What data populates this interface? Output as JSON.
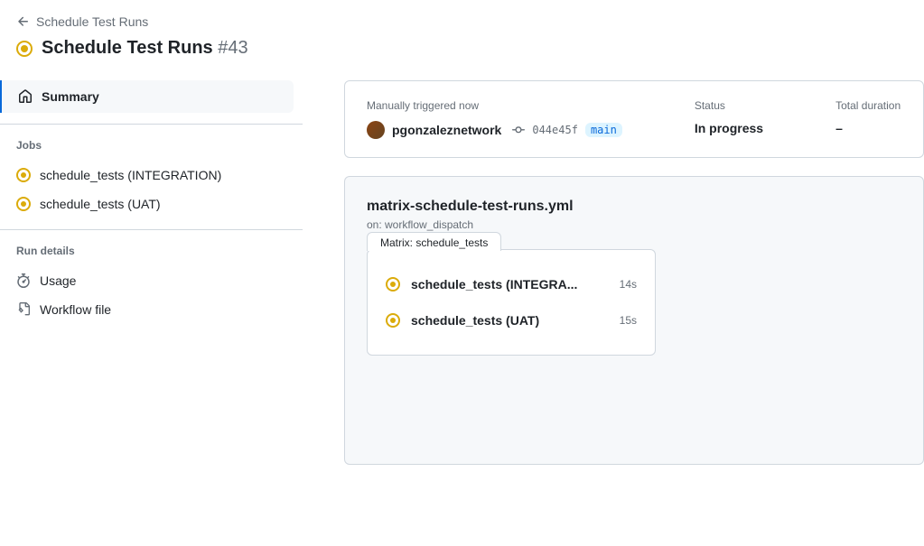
{
  "breadcrumb": {
    "parent": "Schedule Test Runs"
  },
  "title": {
    "name": "Schedule Test Runs",
    "run_number": "#43"
  },
  "sidebar": {
    "summary_label": "Summary",
    "jobs_label": "Jobs",
    "jobs": [
      {
        "name": "schedule_tests (INTEGRATION)"
      },
      {
        "name": "schedule_tests (UAT)"
      }
    ],
    "run_details_label": "Run details",
    "usage_label": "Usage",
    "workflow_file_label": "Workflow file"
  },
  "info": {
    "trigger_label": "Manually triggered now",
    "username": "pgonzaleznetwork",
    "commit": "044e45f",
    "branch": "main",
    "status_label": "Status",
    "status_value": "In progress",
    "duration_label": "Total duration",
    "duration_value": "–"
  },
  "workflow": {
    "file": "matrix-schedule-test-runs.yml",
    "trigger": "on: workflow_dispatch",
    "matrix_label": "Matrix: schedule_tests",
    "jobs": [
      {
        "name": "schedule_tests (INTEGRA...",
        "time": "14s"
      },
      {
        "name": "schedule_tests (UAT)",
        "time": "15s"
      }
    ]
  }
}
